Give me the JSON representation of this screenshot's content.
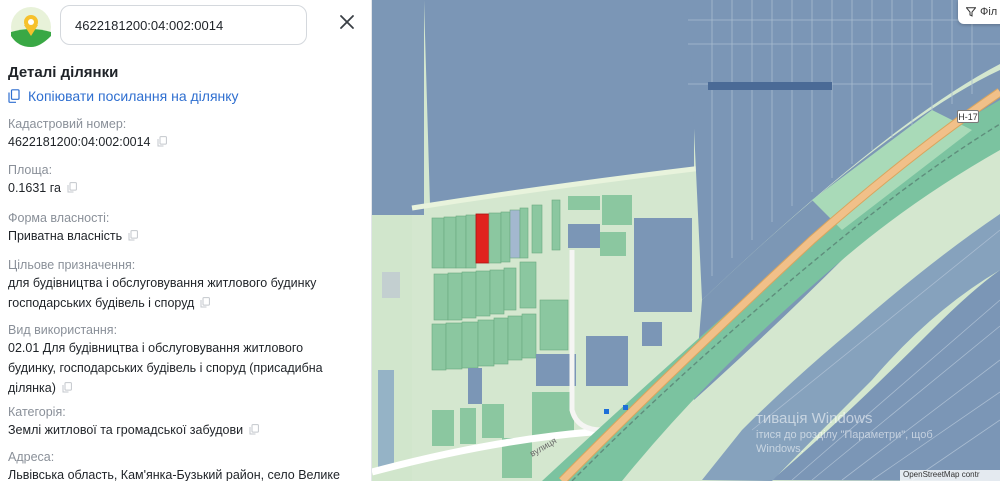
{
  "search": {
    "value": "4622181200:04:002:0014"
  },
  "details": {
    "title": "Деталі ділянки",
    "copy_link": "Копіювати посилання на ділянку",
    "fields": [
      {
        "label": "Кадастровий номер:",
        "lines": [
          "4622181200:04:002:0014"
        ]
      },
      {
        "label": "Площа:",
        "lines": [
          "0.1631 га"
        ]
      },
      {
        "label": "Форма власності:",
        "lines": [
          "Приватна власність"
        ]
      },
      {
        "label": "Цільове призначення:",
        "lines": [
          "для будівництва і обслуговування житлового будинку",
          "господарських будівель і споруд"
        ]
      },
      {
        "label": "Вид використання:",
        "lines": [
          "02.01 Для будівництва і обслуговування житлового",
          "будинку, господарських будівель і споруд (присадибна",
          "ділянка)"
        ]
      },
      {
        "label": "Категорія:",
        "lines": [
          "Землі житлової та громадської забудови"
        ]
      },
      {
        "label": "Адреса:",
        "lines": [
          "Львівська область, Кам'янка-Бузький район, село Велике"
        ]
      }
    ]
  },
  "map": {
    "filter_label": "Філ",
    "road_badge": "Н-17",
    "street_label": "вулиця",
    "watermark_title": "тивація Windows",
    "watermark_line1": "ітися до розділу \"Параметри\", щоб",
    "watermark_line2": "Windows.",
    "attribution": "OpenStreetMap contr",
    "colors": {
      "base": "#d4e7cf",
      "parcel_blue": "#7b96b6",
      "parcel_green": "#8bc7a0",
      "selected": "#e0221e",
      "road": "#f1c089",
      "road_edge": "#d9a55e",
      "buffer": "#7bc3a0"
    }
  }
}
